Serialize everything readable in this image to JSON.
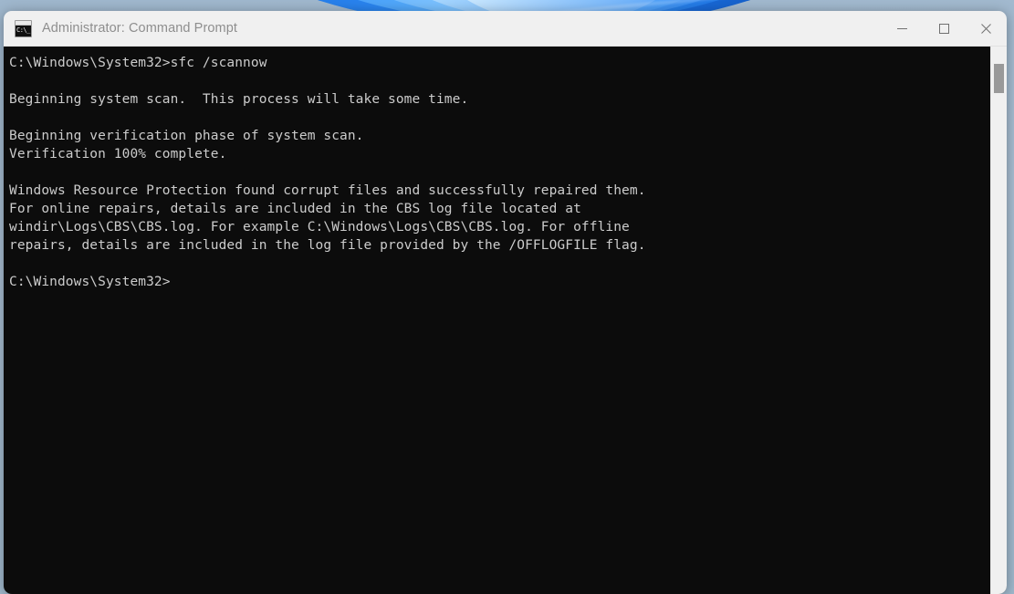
{
  "window": {
    "title": "Administrator: Command Prompt",
    "icon": "command-prompt-icon",
    "icon_text": "C:\\_",
    "controls": {
      "minimize_label": "Minimize",
      "maximize_label": "Maximize",
      "close_label": "Close"
    }
  },
  "console": {
    "background_color": "#0c0c0c",
    "text_color": "#cccccc",
    "lines": [
      "C:\\Windows\\System32>sfc /scannow",
      "",
      "Beginning system scan.  This process will take some time.",
      "",
      "Beginning verification phase of system scan.",
      "Verification 100% complete.",
      "",
      "Windows Resource Protection found corrupt files and successfully repaired them.",
      "For online repairs, details are included in the CBS log file located at",
      "windir\\Logs\\CBS\\CBS.log. For example C:\\Windows\\Logs\\CBS\\CBS.log. For offline",
      "repairs, details are included in the log file provided by the /OFFLOGFILE flag.",
      "",
      "C:\\Windows\\System32>"
    ]
  },
  "scrollbar": {
    "track_color": "#f0f0f0",
    "thumb_color": "#999999"
  },
  "desktop": {
    "wallpaper": "windows-11-bloom",
    "base_color": "#9fb7cd"
  }
}
